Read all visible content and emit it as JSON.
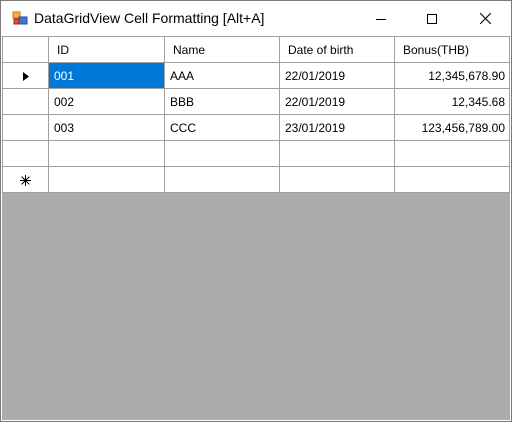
{
  "window": {
    "title": "DataGridView Cell Formatting [Alt+A]",
    "icon": "winforms-app-icon",
    "controls": [
      "minimize-icon",
      "maximize-icon",
      "close-icon"
    ]
  },
  "grid": {
    "columns": [
      "ID",
      "Name",
      "Date of birth",
      "Bonus(THB)"
    ],
    "rows": [
      {
        "id": "001",
        "name": "AAA",
        "dob": "22/01/2019",
        "bonus": "12,345,678.90"
      },
      {
        "id": "002",
        "name": "BBB",
        "dob": "22/01/2019",
        "bonus": "12,345.68"
      },
      {
        "id": "003",
        "name": "CCC",
        "dob": "23/01/2019",
        "bonus": "123,456,789.00"
      }
    ],
    "current_row_marker": "triangle-right-icon",
    "new_row_marker": "asterisk-icon",
    "selection_color": "#0078d7",
    "background_color": "#ababab"
  }
}
